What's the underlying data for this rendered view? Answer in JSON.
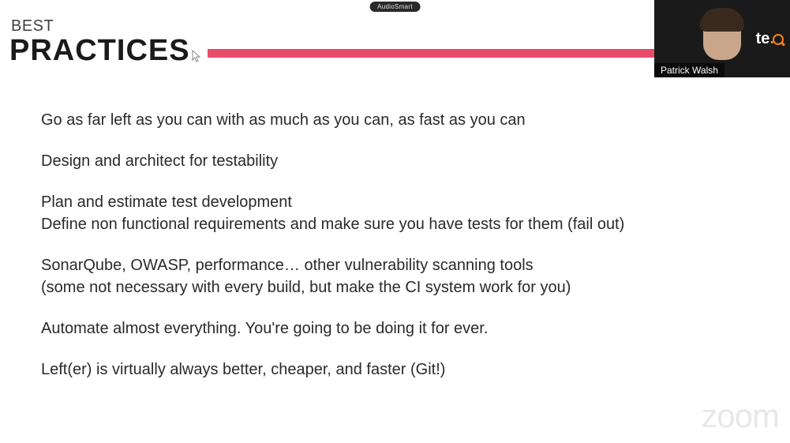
{
  "badge": "AudioSmart",
  "header": {
    "subtitle": "BEST",
    "title": "PRACTICES"
  },
  "accent_color": "#e94b6b",
  "content_lines": [
    "Go as far left as you can with as much as you can, as fast as you can",
    "",
    "Design and architect for testability",
    "",
    "Plan and estimate test development",
    "Define non functional requirements and make sure you have tests for them (fail out)",
    "",
    "SonarQube, OWASP, performance… other vulnerability scanning tools",
    "(some not necessary with every build, but make the CI system work for you)",
    "",
    "Automate almost everything. You're going to be doing it for ever.",
    "",
    "Left(er) is virtually always better, cheaper, and faster (Git!)"
  ],
  "webcam": {
    "speaker_name": "Patrick Walsh",
    "logo_text": "te",
    "logo_accent": "."
  },
  "watermark": "zoom"
}
